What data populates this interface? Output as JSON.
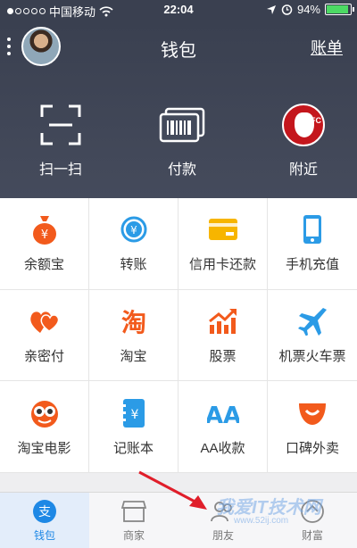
{
  "status_bar": {
    "carrier": "中国移动",
    "time": "22:04",
    "battery": "94%",
    "battery_level": 0.94
  },
  "header": {
    "title": "钱包",
    "bill_label": "账单"
  },
  "quick_actions": [
    {
      "label": "扫一扫",
      "icon": "scan-icon"
    },
    {
      "label": "付款",
      "icon": "barcode-pay-icon"
    },
    {
      "label": "附近",
      "icon": "kfc-logo-icon"
    }
  ],
  "services": [
    {
      "label": "余额宝",
      "icon": "money-bag-icon",
      "color": "#f25a1c"
    },
    {
      "label": "转账",
      "icon": "transfer-icon",
      "color": "#2b9be6"
    },
    {
      "label": "信用卡还款",
      "icon": "credit-card-icon",
      "color": "#f7b500"
    },
    {
      "label": "手机充值",
      "icon": "mobile-phone-icon",
      "color": "#2b9be6"
    },
    {
      "label": "亲密付",
      "icon": "hearts-icon",
      "color": "#f25a1c"
    },
    {
      "label": "淘宝",
      "icon": "taobao-icon",
      "color": "#f25a1c"
    },
    {
      "label": "股票",
      "icon": "stock-chart-icon",
      "color": "#f25a1c"
    },
    {
      "label": "机票火车票",
      "icon": "airplane-icon",
      "color": "#2b9be6"
    },
    {
      "label": "淘宝电影",
      "icon": "glasses-face-icon",
      "color": "#f25a1c"
    },
    {
      "label": "记账本",
      "icon": "ledger-icon",
      "color": "#2b9be6"
    },
    {
      "label": "AA收款",
      "icon": "aa-icon",
      "color": "#2b9be6"
    },
    {
      "label": "口碑外卖",
      "icon": "smile-bowl-icon",
      "color": "#f25a1c"
    }
  ],
  "tabs": [
    {
      "label": "钱包",
      "icon": "alipay-icon",
      "active": true
    },
    {
      "label": "商家",
      "icon": "store-icon",
      "active": false
    },
    {
      "label": "朋友",
      "icon": "friends-icon",
      "active": false
    },
    {
      "label": "财富",
      "icon": "wealth-icon",
      "active": false
    }
  ],
  "watermark": {
    "text": "我爱IT技术网",
    "url": "www.52ij.com"
  },
  "colors": {
    "header_bg": "#3a4050",
    "accent_blue": "#1e88e5",
    "accent_orange": "#f25a1c"
  }
}
